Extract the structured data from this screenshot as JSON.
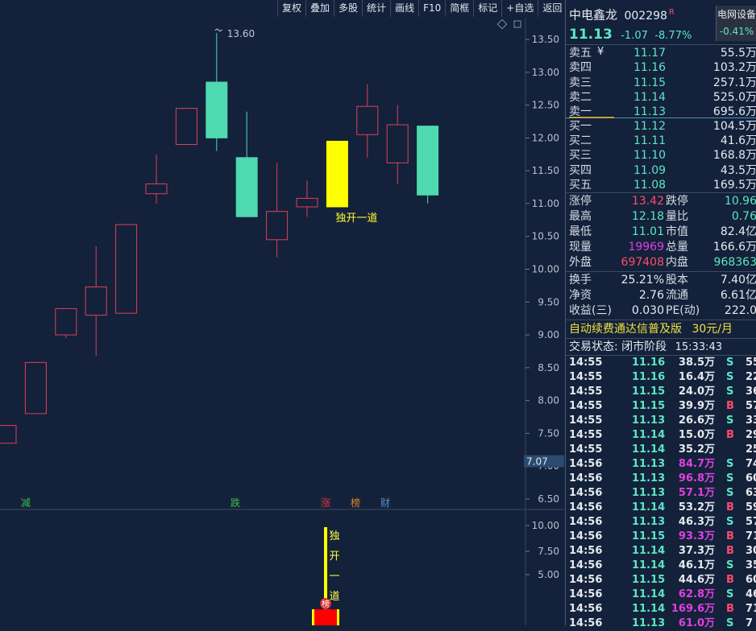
{
  "toolbar": [
    "复权",
    "叠加",
    "多股",
    "统计",
    "画线",
    "F10",
    "简框",
    "标记",
    "+自选",
    "返回"
  ],
  "stock": {
    "name": "中电鑫龙",
    "code": "002298",
    "flag": "R",
    "sector": "电网设备",
    "sector_change": "-0.41%",
    "price": "11.13",
    "change": "-1.07",
    "change_pct": "-8.77%"
  },
  "chart": {
    "high_label": "13.60",
    "price_ticks": [
      "13.50",
      "13.00",
      "12.50",
      "12.00",
      "11.50",
      "11.00",
      "10.50",
      "10.00",
      "9.50",
      "9.00",
      "8.50",
      "8.00",
      "7.50",
      "7.00",
      "6.50"
    ],
    "cursor_price": "7.07",
    "candle_annotation": "独开一道",
    "markers": [
      {
        "text": "减",
        "color": "#2ec050"
      },
      {
        "text": "跌",
        "color": "#2ec050"
      },
      {
        "text": "涨",
        "color": "#e03040"
      },
      {
        "text": "榜",
        "color": "#e08030"
      },
      {
        "text": "财",
        "color": "#4a90e0"
      }
    ],
    "volume_ticks": [
      "10.00",
      "7.50",
      "5.00"
    ],
    "volume_annotation": [
      "独",
      "开",
      "一",
      "道"
    ],
    "volume_badge": "榜"
  },
  "chart_data": {
    "type": "candlestick",
    "ylim": [
      6.5,
      13.5
    ],
    "candles": [
      {
        "open": 7.35,
        "close": 7.62,
        "high": 7.62,
        "low": 7.35
      },
      {
        "open": 7.8,
        "close": 8.58,
        "high": 8.58,
        "low": 7.8
      },
      {
        "open": 9.0,
        "close": 9.4,
        "high": 9.4,
        "low": 8.95
      },
      {
        "open": 9.3,
        "close": 9.73,
        "high": 10.35,
        "low": 8.68
      },
      {
        "open": 9.33,
        "close": 10.68,
        "high": 10.68,
        "low": 9.33
      },
      {
        "open": 11.15,
        "close": 11.3,
        "high": 11.75,
        "low": 11.0
      },
      {
        "open": 11.9,
        "close": 12.45,
        "high": 12.45,
        "low": 11.9
      },
      {
        "open": 12.85,
        "close": 12.0,
        "high": 13.6,
        "low": 11.8
      },
      {
        "open": 11.7,
        "close": 10.8,
        "high": 12.4,
        "low": 10.8
      },
      {
        "open": 10.45,
        "close": 10.88,
        "high": 11.62,
        "low": 10.18
      },
      {
        "open": 10.95,
        "close": 11.08,
        "high": 11.35,
        "low": 10.8
      },
      {
        "open": 10.95,
        "close": 11.95,
        "high": 11.95,
        "low": 10.95
      },
      {
        "open": 12.05,
        "close": 12.48,
        "high": 12.82,
        "low": 11.7
      },
      {
        "open": 11.62,
        "close": 12.2,
        "high": 12.5,
        "low": 11.3
      },
      {
        "open": 12.18,
        "close": 11.13,
        "high": 12.18,
        "low": 11.0
      }
    ]
  },
  "book": {
    "asks": [
      {
        "label": "卖五",
        "price": "11.17",
        "vol": "55.5万"
      },
      {
        "label": "卖四",
        "price": "11.16",
        "vol": "103.2万"
      },
      {
        "label": "卖三",
        "price": "11.15",
        "vol": "257.1万"
      },
      {
        "label": "卖二",
        "price": "11.14",
        "vol": "525.0万"
      },
      {
        "label": "卖一",
        "price": "11.13",
        "vol": "695.6万"
      }
    ],
    "bids": [
      {
        "label": "买一",
        "price": "11.12",
        "vol": "104.5万"
      },
      {
        "label": "买二",
        "price": "11.11",
        "vol": "41.6万"
      },
      {
        "label": "买三",
        "price": "11.10",
        "vol": "168.8万"
      },
      {
        "label": "买四",
        "price": "11.09",
        "vol": "43.5万"
      },
      {
        "label": "买五",
        "price": "11.08",
        "vol": "169.5万"
      }
    ],
    "ask_marker": "¥"
  },
  "stats": [
    {
      "l1": "涨停",
      "v1": "13.42",
      "c1": "red",
      "l2": "跌停",
      "v2": "10.96",
      "c2": "green"
    },
    {
      "l1": "最高",
      "v1": "12.18",
      "c1": "green",
      "l2": "量比",
      "v2": "0.76",
      "c2": "green"
    },
    {
      "l1": "最低",
      "v1": "11.01",
      "c1": "green",
      "l2": "市值",
      "v2": "82.4亿",
      "c2": "white"
    },
    {
      "l1": "现量",
      "v1": "19969",
      "c1": "mag",
      "l2": "总量",
      "v2": "166.6万",
      "c2": "white"
    },
    {
      "l1": "外盘",
      "v1": "697408",
      "c1": "red",
      "l2": "内盘",
      "v2": "968363",
      "c2": "green"
    }
  ],
  "stats2": [
    {
      "l1": "换手",
      "v1": "25.21%",
      "l2": "股本",
      "v2": "7.40亿"
    },
    {
      "l1": "净资",
      "v1": "2.76",
      "l2": "流通",
      "v2": "6.61亿"
    },
    {
      "l1": "收益(三)",
      "v1": "0.030",
      "l2": "PE(动)",
      "v2": "222.0"
    }
  ],
  "promo": {
    "text": "自动续费通达信普及版",
    "price": "30元/月"
  },
  "trade_status": {
    "label": "交易状态: 闭市阶段",
    "time": "15:33:43"
  },
  "ticks": [
    {
      "t": "14:55",
      "p": "11.16",
      "v": "38.5万",
      "s": "S",
      "n": "55",
      "vc": "white"
    },
    {
      "t": "14:55",
      "p": "11.16",
      "v": "16.4万",
      "s": "S",
      "n": "22",
      "vc": "white"
    },
    {
      "t": "14:55",
      "p": "11.15",
      "v": "24.0万",
      "s": "S",
      "n": "36",
      "vc": "white"
    },
    {
      "t": "14:55",
      "p": "11.15",
      "v": "39.9万",
      "s": "B",
      "n": "57",
      "vc": "white"
    },
    {
      "t": "14:55",
      "p": "11.13",
      "v": "26.6万",
      "s": "S",
      "n": "33",
      "vc": "white"
    },
    {
      "t": "14:55",
      "p": "11.14",
      "v": "15.0万",
      "s": "B",
      "n": "29",
      "vc": "white"
    },
    {
      "t": "14:55",
      "p": "11.14",
      "v": "35.2万",
      "s": "",
      "n": "25",
      "vc": "white"
    },
    {
      "t": "14:56",
      "p": "11.13",
      "v": "84.7万",
      "s": "S",
      "n": "74",
      "vc": "mag"
    },
    {
      "t": "14:56",
      "p": "11.13",
      "v": "96.8万",
      "s": "S",
      "n": "60",
      "vc": "mag"
    },
    {
      "t": "14:56",
      "p": "11.13",
      "v": "57.1万",
      "s": "S",
      "n": "63",
      "vc": "mag"
    },
    {
      "t": "14:56",
      "p": "11.14",
      "v": "53.2万",
      "s": "B",
      "n": "59",
      "vc": "white"
    },
    {
      "t": "14:56",
      "p": "11.13",
      "v": "46.3万",
      "s": "S",
      "n": "57",
      "vc": "white"
    },
    {
      "t": "14:56",
      "p": "11.15",
      "v": "93.3万",
      "s": "B",
      "n": "71",
      "vc": "mag"
    },
    {
      "t": "14:56",
      "p": "11.14",
      "v": "37.3万",
      "s": "B",
      "n": "30",
      "vc": "white"
    },
    {
      "t": "14:56",
      "p": "11.14",
      "v": "46.1万",
      "s": "S",
      "n": "35",
      "vc": "white"
    },
    {
      "t": "14:56",
      "p": "11.15",
      "v": "44.6万",
      "s": "B",
      "n": "60",
      "vc": "white"
    },
    {
      "t": "14:56",
      "p": "11.14",
      "v": "62.8万",
      "s": "S",
      "n": "46",
      "vc": "mag"
    },
    {
      "t": "14:56",
      "p": "11.14",
      "v": "169.6万",
      "s": "B",
      "n": "71",
      "vc": "mag"
    },
    {
      "t": "14:56",
      "p": "11.13",
      "v": "61.0万",
      "s": "S",
      "n": "7",
      "vc": "mag"
    }
  ]
}
